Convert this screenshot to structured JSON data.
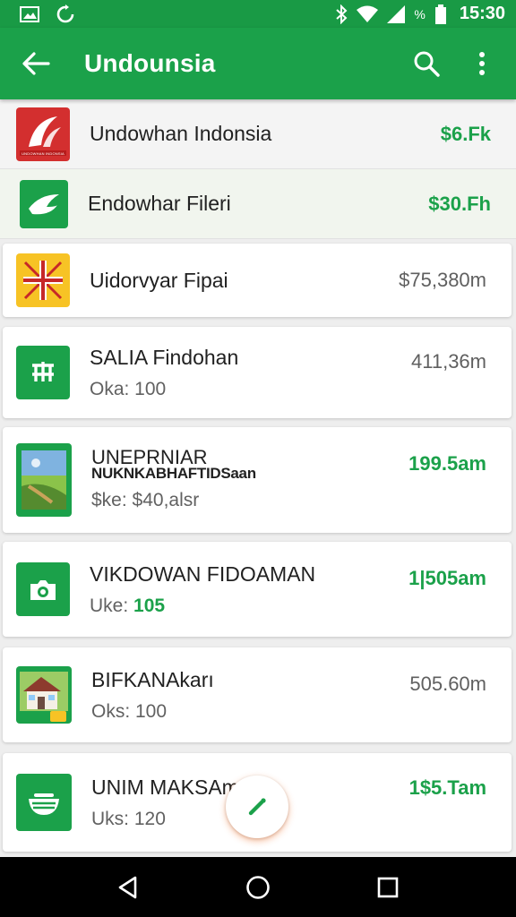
{
  "status_bar": {
    "time": "15:30",
    "percent_label": "%",
    "icons": [
      "image-icon",
      "sync-icon",
      "bluetooth-icon",
      "wifi-icon",
      "signal-icon",
      "battery-icon"
    ]
  },
  "app_bar": {
    "title": "Undounsia",
    "background": "#1ba14a",
    "icons": [
      "back-arrow-icon",
      "search-icon",
      "more-vert-icon"
    ]
  },
  "items": [
    {
      "title": "Undowhan Indonsia",
      "subtitle": "",
      "value": "$6.Fk",
      "value_color": "#1ba14a",
      "icon": "red-bird-logo-icon",
      "logo_caption": "UNDOWHAN INDONSIA"
    },
    {
      "title": "Endowhar Fileri",
      "subtitle": "",
      "value": "$30.Fh",
      "value_color": "#1ba14a",
      "icon": "leaf-logo-icon"
    },
    {
      "title": "Uidorvyar Fipai",
      "subtitle": "",
      "value": "$75,380m",
      "value_color": "#5f5f5f",
      "icon": "union-flag-icon"
    },
    {
      "title": "SALIA Findohan",
      "subtitle": "Oka: 100",
      "value": "411,36m",
      "value_color": "#5f5f5f",
      "icon": "gate-icon"
    },
    {
      "title": "UNEPRNIAR",
      "title2": "NUKNKABHAFTIDSaan",
      "subtitle": "$ke: $40,alsr",
      "value": "199.5am",
      "value_color": "#1ba14a",
      "icon": "landscape-photo-icon"
    },
    {
      "title": "VIKDOWAN FIDOAMAN",
      "subtitle_prefix": "Uke: ",
      "subtitle_highlight": "105",
      "value": "1|505am",
      "value_color": "#1ba14a",
      "icon": "camera-icon"
    },
    {
      "title": "BIFKANAkarı",
      "subtitle": "Oks: 100",
      "value": "505.60m",
      "value_color": "#5f5f5f",
      "icon": "house-photo-icon"
    },
    {
      "title": "UNIM MAKSAm",
      "subtitle": "Uks: 120",
      "value": "1$5.Tam",
      "value_color": "#1ba14a",
      "icon": "bowl-icon"
    }
  ],
  "fab": {
    "icon": "edit-pencil-icon"
  },
  "nav_bar": {
    "icons": [
      "back-triangle-icon",
      "home-circle-icon",
      "recents-square-icon"
    ]
  }
}
